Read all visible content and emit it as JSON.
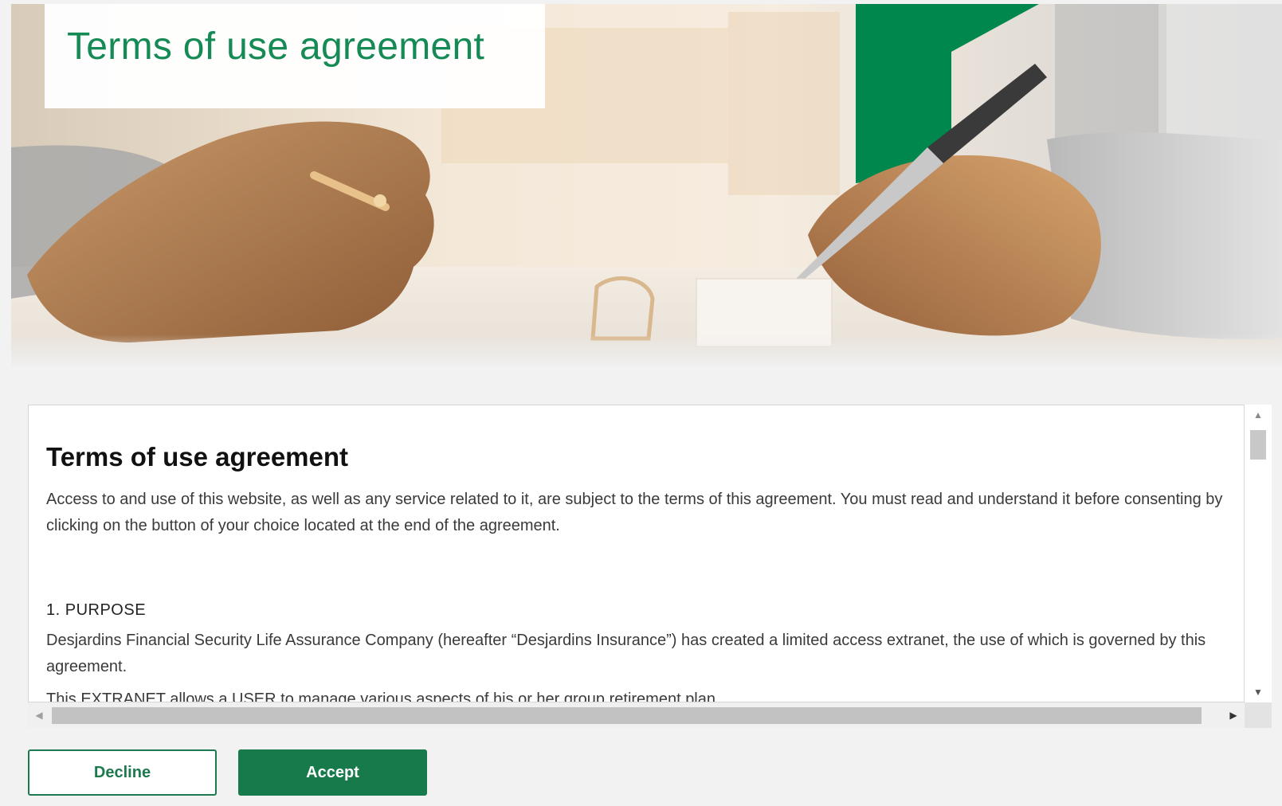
{
  "hero": {
    "title": "Terms of use agreement",
    "brand_color": "#00874e"
  },
  "agreement": {
    "heading": "Terms of use agreement",
    "intro": "Access to and use of this website, as well as any service related to it, are subject to the terms of this agreement. You must read and understand it before consenting by clicking on the button of your choice located at the end of the agreement.",
    "sections": [
      {
        "title": "1. PURPOSE",
        "paragraphs": [
          "Desjardins Financial Security Life Assurance Company (hereafter “Desjardins Insurance”) has created a limited access extranet, the use of which is governed by this agreement.",
          "This EXTRANET allows a USER to manage various aspects of his or her group retirement plan"
        ]
      }
    ]
  },
  "scrollbars": {
    "up_icon": "triangle-up-icon",
    "down_icon": "triangle-down-icon",
    "left_icon": "triangle-left-icon",
    "right_icon": "triangle-right-icon"
  },
  "actions": {
    "decline_label": "Decline",
    "accept_label": "Accept",
    "accent_color": "#177a4a"
  }
}
